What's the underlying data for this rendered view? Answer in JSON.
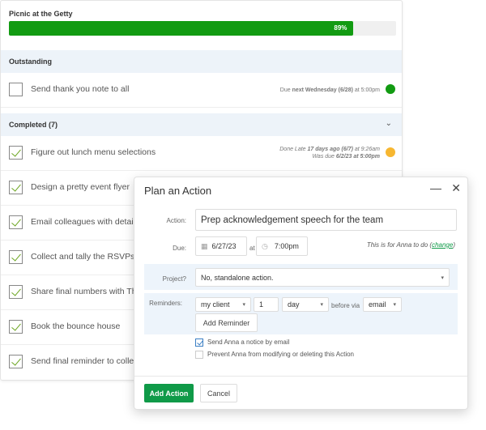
{
  "project": {
    "title": "Picnic at the Getty",
    "progress_percent": 89,
    "progress_label": "89%"
  },
  "outstanding": {
    "header": "Outstanding",
    "items": [
      {
        "text": "Send thank you note to all",
        "due_prefix": "Due ",
        "due_bold": "next Wednesday (6/28)",
        "due_suffix": " at 5:00pm",
        "status_color": "#129b12"
      }
    ]
  },
  "completed": {
    "header": "Completed (7)",
    "items": [
      {
        "text": "Figure out lunch menu selections",
        "line1_prefix": "Done Late ",
        "line1_bold": "17 days ago (6/7)",
        "line1_suffix": " at 9:26am",
        "line2_prefix": "Was due ",
        "line2_bold": "6/2/23 at 5:00pm",
        "status_color": "#f7b731"
      },
      {
        "text": "Design a pretty event flyer"
      },
      {
        "text": "Email colleagues with detai"
      },
      {
        "text": "Collect and tally the RSVPs"
      },
      {
        "text": "Share final numbers with Th"
      },
      {
        "text": "Book the bounce house"
      },
      {
        "text": "Send final reminder to colle"
      }
    ]
  },
  "dialog": {
    "title": "Plan an Action",
    "minimize_icon": "minus",
    "close_icon": "x",
    "action_label": "Action:",
    "action_value": "Prep acknowledgement speech for the team",
    "due_label": "Due:",
    "due_date": "6/27/23",
    "at": "at",
    "due_time": "7:00pm",
    "assignee_prefix": "This is for Anna to do (",
    "assignee_link": "change",
    "assignee_suffix": ")",
    "project_label": "Project?",
    "project_value": "No, standalone action.",
    "reminders_label": "Reminders:",
    "reminder_who": "my client",
    "reminder_amount": "1",
    "reminder_unit": "day",
    "before_via": "before via",
    "reminder_channel": "email",
    "add_reminder": "Add Reminder",
    "notify_label": "Send Anna a notice by email",
    "notify_checked": true,
    "prevent_label": "Prevent Anna from modifying or deleting this Action",
    "prevent_checked": false,
    "submit": "Add Action",
    "cancel": "Cancel",
    "accent": "#0f9a48"
  }
}
